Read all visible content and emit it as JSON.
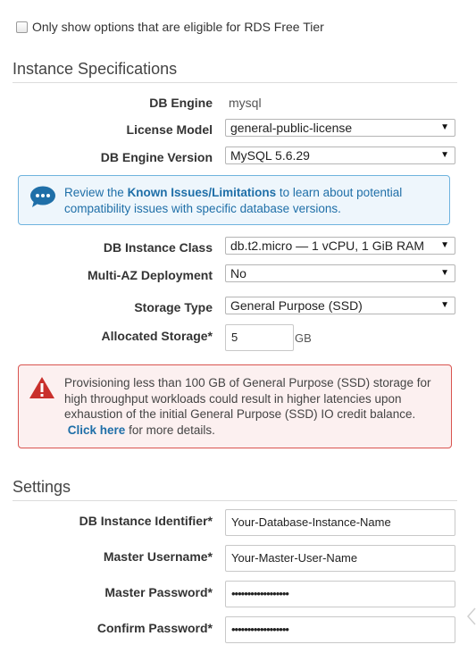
{
  "free_tier": {
    "label": "Only show options that are eligible for RDS Free Tier",
    "checked": false
  },
  "instance_specs": {
    "title": "Instance Specifications",
    "db_engine": {
      "label": "DB Engine",
      "value": "mysql"
    },
    "license_model": {
      "label": "License Model",
      "value": "general-public-license"
    },
    "engine_version": {
      "label": "DB Engine Version",
      "value": "MySQL 5.6.29"
    },
    "info": {
      "prefix": "Review the",
      "link": "Known Issues/Limitations",
      "suffix": "to learn about potential compatibility issues with specific database versions."
    },
    "instance_class": {
      "label": "DB Instance Class",
      "value": "db.t2.micro — 1 vCPU, 1 GiB RAM"
    },
    "multi_az": {
      "label": "Multi-AZ Deployment",
      "value": "No"
    },
    "storage_type": {
      "label": "Storage Type",
      "value": "General Purpose (SSD)"
    },
    "allocated_storage": {
      "label": "Allocated Storage*",
      "value": "5",
      "unit": "GB"
    },
    "warning": {
      "text": "Provisioning less than 100 GB of General Purpose (SSD) storage for high throughput workloads could result in higher latencies upon exhaustion of the initial General Purpose (SSD) IO credit balance.",
      "link": "Click here",
      "suffix": "for more details."
    }
  },
  "settings": {
    "title": "Settings",
    "instance_identifier": {
      "label": "DB Instance Identifier*",
      "value": "Your-Database-Instance-Name"
    },
    "master_username": {
      "label": "Master Username*",
      "value": "Your-Master-User-Name"
    },
    "master_password": {
      "label": "Master Password*",
      "value": "••••••••••••••••••"
    },
    "confirm_password": {
      "label": "Confirm Password*",
      "value": "••••••••••••••••••"
    }
  },
  "colors": {
    "info_accent": "#1f6fa8",
    "warning_accent": "#d9534f"
  },
  "icons": {
    "info": "speech-bubble-icon",
    "warning": "warning-triangle-icon",
    "dropdown": "caret-down-icon",
    "side": "chevron-left-icon"
  }
}
